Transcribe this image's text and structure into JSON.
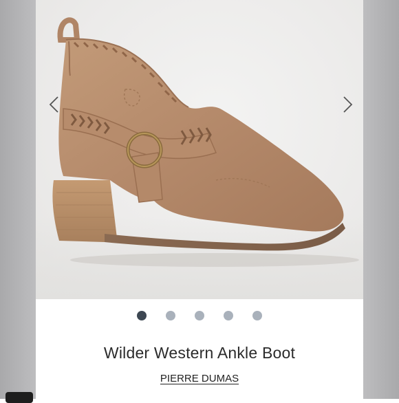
{
  "product": {
    "title": "Wilder Western Ankle Boot",
    "brand": "PIERRE DUMAS"
  },
  "gallery": {
    "image_alt": "tan suede western ankle boot with harness ring",
    "prev_icon": "chevron-left-icon",
    "next_icon": "chevron-right-icon",
    "dot_count": 5,
    "active_index": 0
  },
  "colors": {
    "active_dot": "#3d4752",
    "inactive_dot": "#a9b1bb",
    "suede": "#b88d6c"
  }
}
